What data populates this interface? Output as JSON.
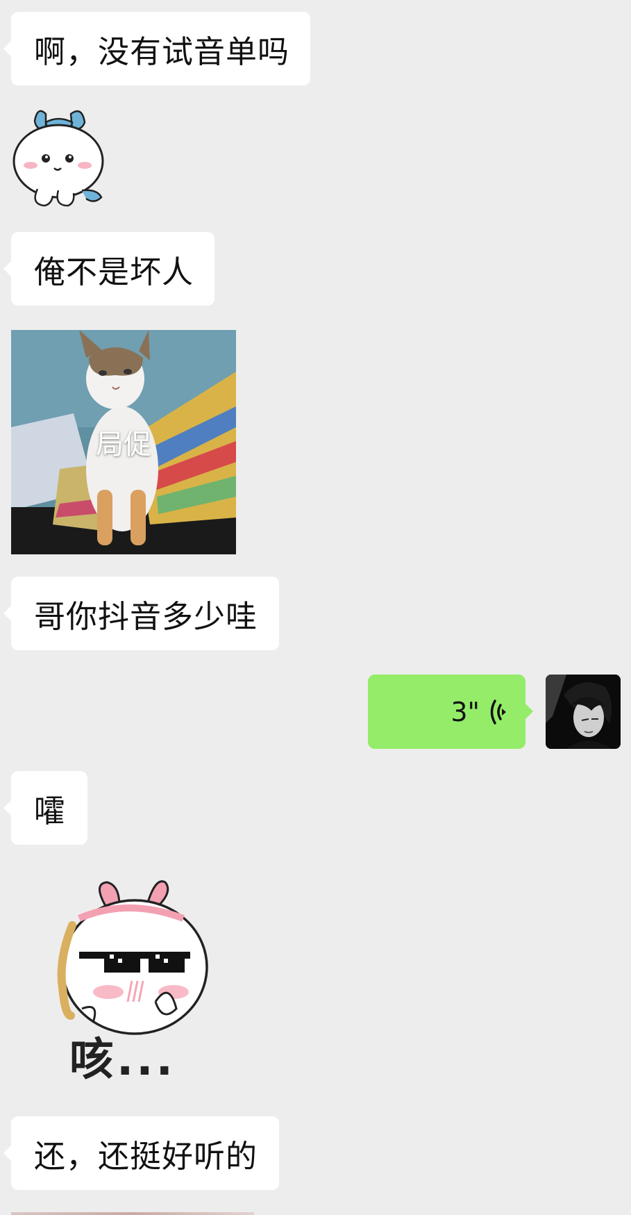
{
  "messages": [
    {
      "type": "text",
      "side": "in",
      "text": "啊，没有试音单吗"
    },
    {
      "type": "sticker",
      "side": "in",
      "sticker": "blue-bow-white-creature-sticker"
    },
    {
      "type": "text",
      "side": "in",
      "text": "俺不是坏人"
    },
    {
      "type": "image",
      "side": "in",
      "caption": "局促",
      "sticker": "cat-photo"
    },
    {
      "type": "text",
      "side": "in",
      "text": "哥你抖音多少哇"
    },
    {
      "type": "voice",
      "side": "out",
      "duration": "3\"",
      "icon": "voice-wave-icon"
    },
    {
      "type": "text",
      "side": "in",
      "text": "嚯"
    },
    {
      "type": "sticker",
      "side": "in",
      "sticker": "sunglasses-bunny-sticker",
      "caption": "咳..."
    },
    {
      "type": "text",
      "side": "in",
      "text": "还，还挺好听的"
    }
  ],
  "colors": {
    "background": "#ededed",
    "incoming_bubble": "#ffffff",
    "outgoing_bubble": "#95ec69"
  }
}
